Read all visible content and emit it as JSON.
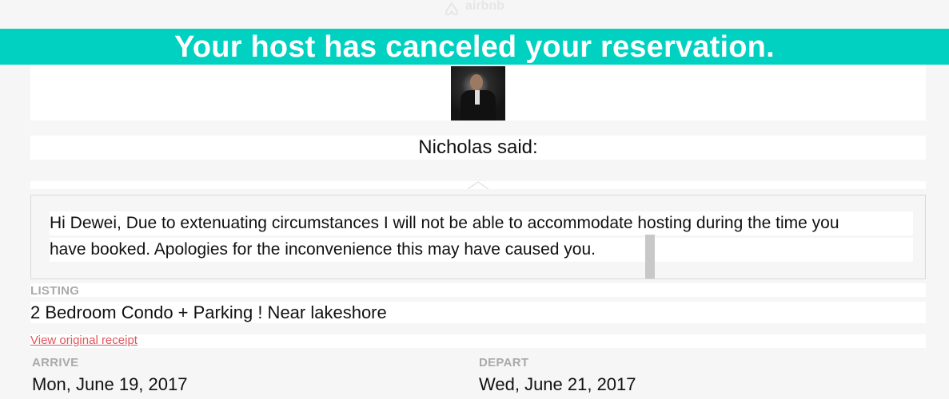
{
  "brand": {
    "logo_text": "airbnb"
  },
  "banner": {
    "title": "Your host has canceled your reservation."
  },
  "host": {
    "said_label": "Nicholas said:"
  },
  "message": {
    "line1": "Hi Dewei, Due to extenuating circumstances I will not be able to accommodate hosting during the time you",
    "line2": "have booked. Apologies for the inconvenience this may have caused you."
  },
  "listing": {
    "label": "LISTING",
    "name": "2 Bedroom Condo + Parking ! Near lakeshore"
  },
  "receipt_link": "View original receipt",
  "dates": {
    "arrive_label": "ARRIVE",
    "arrive_value": "Mon, June 19, 2017",
    "depart_label": "DEPART",
    "depart_value": "Wed, June 21, 2017"
  },
  "colors": {
    "banner": "#00d1c1",
    "link": "#e0565b"
  }
}
